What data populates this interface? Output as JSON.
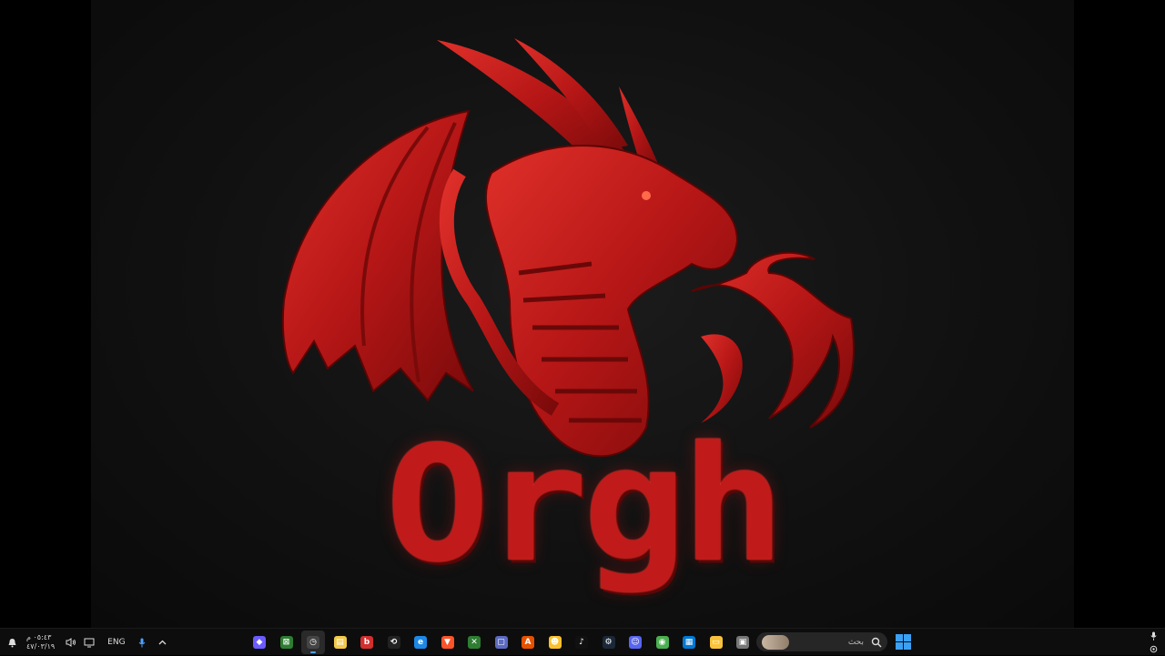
{
  "wallpaper": {
    "logo_text": "Orgh",
    "accent": "#c01a1a"
  },
  "taskbar": {
    "clock": {
      "time": "٠٥:٤٣ م",
      "date": "٤٧/٠٣/١٩"
    },
    "lang": "ENG",
    "search": {
      "placeholder": "بحث"
    },
    "apps": [
      {
        "name": "copilot-icon",
        "color": "#6b5cff",
        "glyph": "◆"
      },
      {
        "name": "terminal-icon",
        "color": "#2e7d32",
        "glyph": "⊠"
      },
      {
        "name": "clock-app-icon",
        "color": "#444",
        "glyph": "◷"
      },
      {
        "name": "notes-icon",
        "color": "#f2c94c",
        "glyph": "▤"
      },
      {
        "name": "b-app-icon",
        "color": "#d32f2f",
        "glyph": "b"
      },
      {
        "name": "capcut-icon",
        "color": "#222",
        "glyph": "⟲"
      },
      {
        "name": "edge-icon",
        "color": "#1e88e5",
        "glyph": "e"
      },
      {
        "name": "brave-icon",
        "color": "#fb542b",
        "glyph": "▼"
      },
      {
        "name": "xbox-icon",
        "color": "#2e7d32",
        "glyph": "✕"
      },
      {
        "name": "phone-link-icon",
        "color": "#5c6bc0",
        "glyph": "▢"
      },
      {
        "name": "office-icon",
        "color": "#e65100",
        "glyph": "A"
      },
      {
        "name": "discord-bot-icon",
        "color": "#fbc02d",
        "glyph": "☻"
      },
      {
        "name": "tiktok-icon",
        "color": "#111",
        "glyph": "♪"
      },
      {
        "name": "steam-icon",
        "color": "#1b2838",
        "glyph": "⚙"
      },
      {
        "name": "discord-icon",
        "color": "#5865f2",
        "glyph": "☺"
      },
      {
        "name": "chrome-icon",
        "color": "#4caf50",
        "glyph": "◉"
      },
      {
        "name": "store-icon",
        "color": "#0078d4",
        "glyph": "▦"
      },
      {
        "name": "explorer-icon",
        "color": "#f9c23c",
        "glyph": "▭"
      },
      {
        "name": "window-icon",
        "color": "#777",
        "glyph": "▣"
      }
    ]
  }
}
